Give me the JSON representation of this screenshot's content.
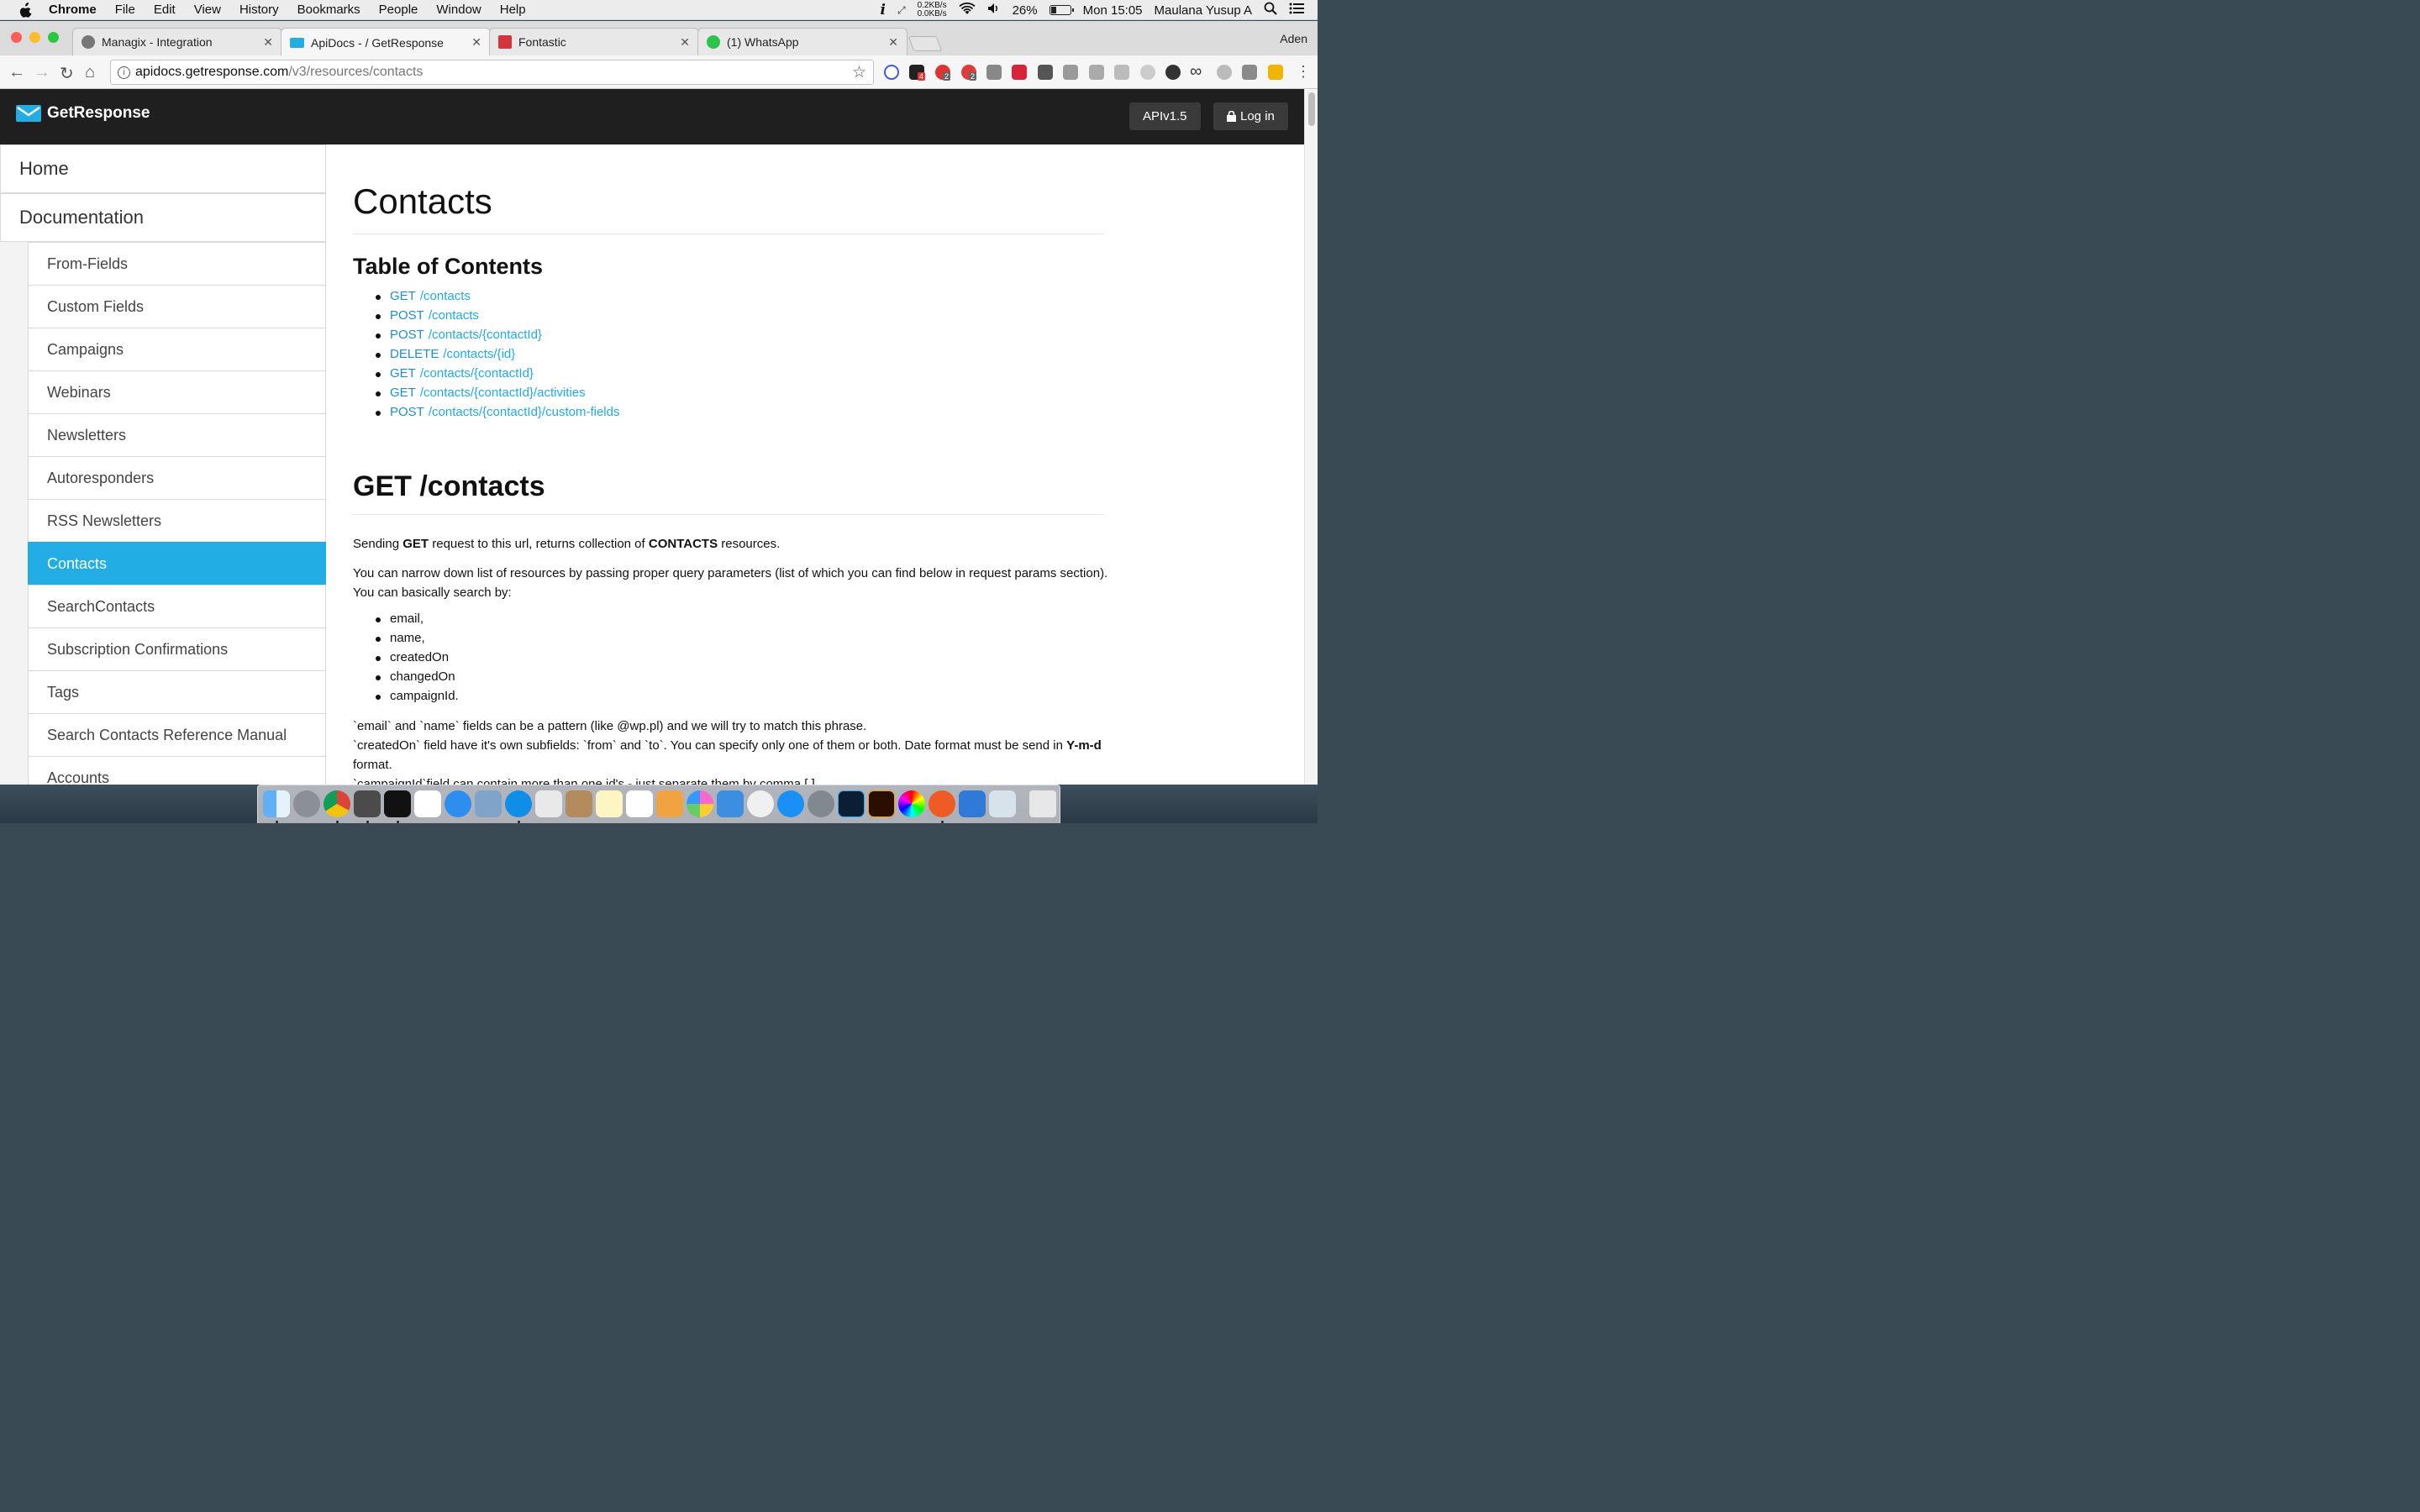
{
  "menubar": {
    "app": "Chrome",
    "items": [
      "File",
      "Edit",
      "View",
      "History",
      "Bookmarks",
      "People",
      "Window",
      "Help"
    ],
    "net_up": "0.2KB/s",
    "net_down": "0.0KB/s",
    "battery_percent": "26%",
    "battery_level": 0.26,
    "clock": "Mon 15:05",
    "user": "Maulana Yusup A"
  },
  "browser": {
    "profile": "Aden",
    "tabs": [
      {
        "title": "Managix - Integration",
        "icon": "managix-icon"
      },
      {
        "title": "ApiDocs - / GetResponse",
        "icon": "getresponse-icon"
      },
      {
        "title": "Fontastic",
        "icon": "fontastic-icon"
      },
      {
        "title": "(1) WhatsApp",
        "icon": "whatsapp-icon"
      }
    ],
    "url_host": "apidocs.getresponse.com",
    "url_path": "/v3/resources/contacts",
    "ext_badges": {
      "b1": "4",
      "b2": "2",
      "b3": "2"
    }
  },
  "header": {
    "logo": "GetResponse",
    "api_button": "APIv1.5",
    "login_button": "Log in"
  },
  "sidebar": {
    "top": [
      "Home",
      "Documentation"
    ],
    "items": [
      "From-Fields",
      "Custom Fields",
      "Campaigns",
      "Webinars",
      "Newsletters",
      "Autoresponders",
      "RSS Newsletters",
      "Contacts",
      "SearchContacts",
      "Subscription Confirmations",
      "Tags",
      "Search Contacts Reference Manual",
      "Accounts"
    ],
    "active": "Contacts"
  },
  "content": {
    "title": "Contacts",
    "toc_title": "Table of Contents",
    "toc": [
      {
        "method": "GET",
        "path": "/contacts"
      },
      {
        "method": "POST",
        "path": "/contacts"
      },
      {
        "method": "POST",
        "path": "/contacts/{contactId}"
      },
      {
        "method": "DELETE",
        "path": "/contacts/{id}"
      },
      {
        "method": "GET",
        "path": "/contacts/{contactId}"
      },
      {
        "method": "GET",
        "path": "/contacts/{contactId}/activities"
      },
      {
        "method": "POST",
        "path": "/contacts/{contactId}/custom-fields"
      }
    ],
    "section_title": "GET /contacts",
    "p1_a": "Sending ",
    "p1_b": "GET",
    "p1_c": " request to this url, returns collection of ",
    "p1_d": "CONTACTS",
    "p1_e": " resources.",
    "p2_line1": "You can narrow down list of resources by passing proper query parameters (list of which you can find below in request params section).",
    "p2_line2": "You can basically search by:",
    "search_fields": [
      "email,",
      "name,",
      "createdOn",
      "changedOn",
      "campaignId."
    ],
    "p3_line1": "`email` and `name` fields can be a pattern (like @wp.pl) and we will try to match this phrase.",
    "p3_line2a": "`createdOn` field have it's own subfields: `from` and `to`. You can specify only one of them or both. Date format must be send in ",
    "p3_line2b": "Y-m-d",
    "p3_line3": "format.",
    "p3_line4": "`campaignId`field can contain more than one id's - just separate them by comma [,]"
  },
  "colors": {
    "accent": "#22aee4",
    "link": "#1eaaf0",
    "header_bg": "#1f1f1f"
  }
}
